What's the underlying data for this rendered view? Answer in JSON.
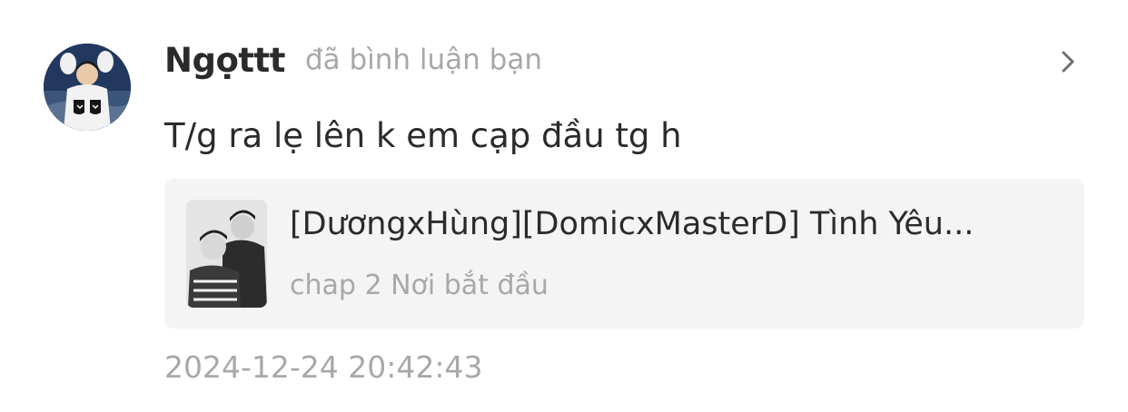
{
  "notification": {
    "username": "Ngọttt",
    "action": "đã bình luận bạn",
    "comment": "T/g ra lẹ lên k em cạp đầu tg h",
    "story": {
      "title": "[DươngxHùng][DomicxMasterD] Tình Yêu...",
      "chapter": "chap 2 Nơi bắt đầu"
    },
    "timestamp": "2024-12-24 20:42:43"
  },
  "icons": {
    "chevron": "chevron-right-icon"
  },
  "colors": {
    "primary_text": "#2b2b2b",
    "secondary_text": "#a8a8a8",
    "card_background": "#f4f4f4"
  }
}
